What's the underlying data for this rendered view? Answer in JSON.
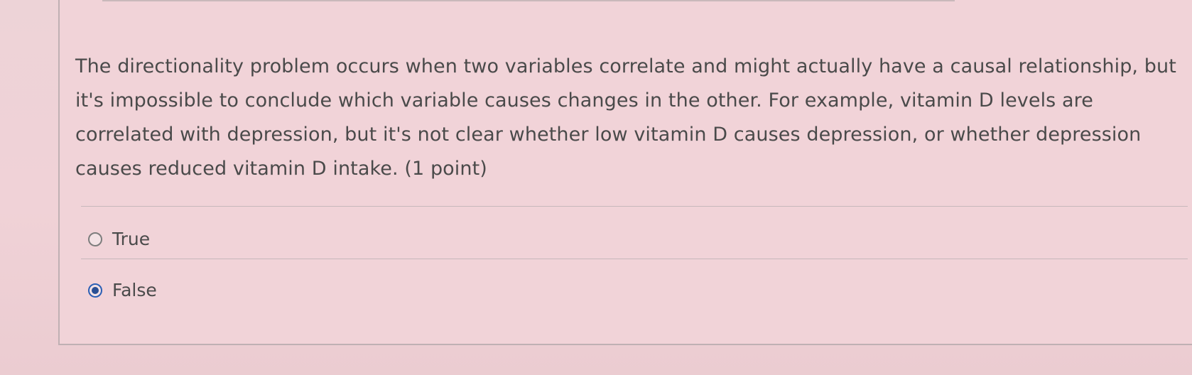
{
  "question": {
    "text": "The directionality problem occurs when two variables correlate and might actually have a causal relationship, but it's impossible to conclude which variable causes changes in the other. For example, vitamin D levels are correlated with depression, but it's not clear whether low vitamin D causes depression, or whether depression causes reduced vitamin D intake. (1 point)"
  },
  "options": [
    {
      "label": "True",
      "selected": false
    },
    {
      "label": "False",
      "selected": true
    }
  ],
  "colors": {
    "background": "#eccfd3",
    "text": "#4a4a4a",
    "radio_selected": "#2a4f94"
  }
}
